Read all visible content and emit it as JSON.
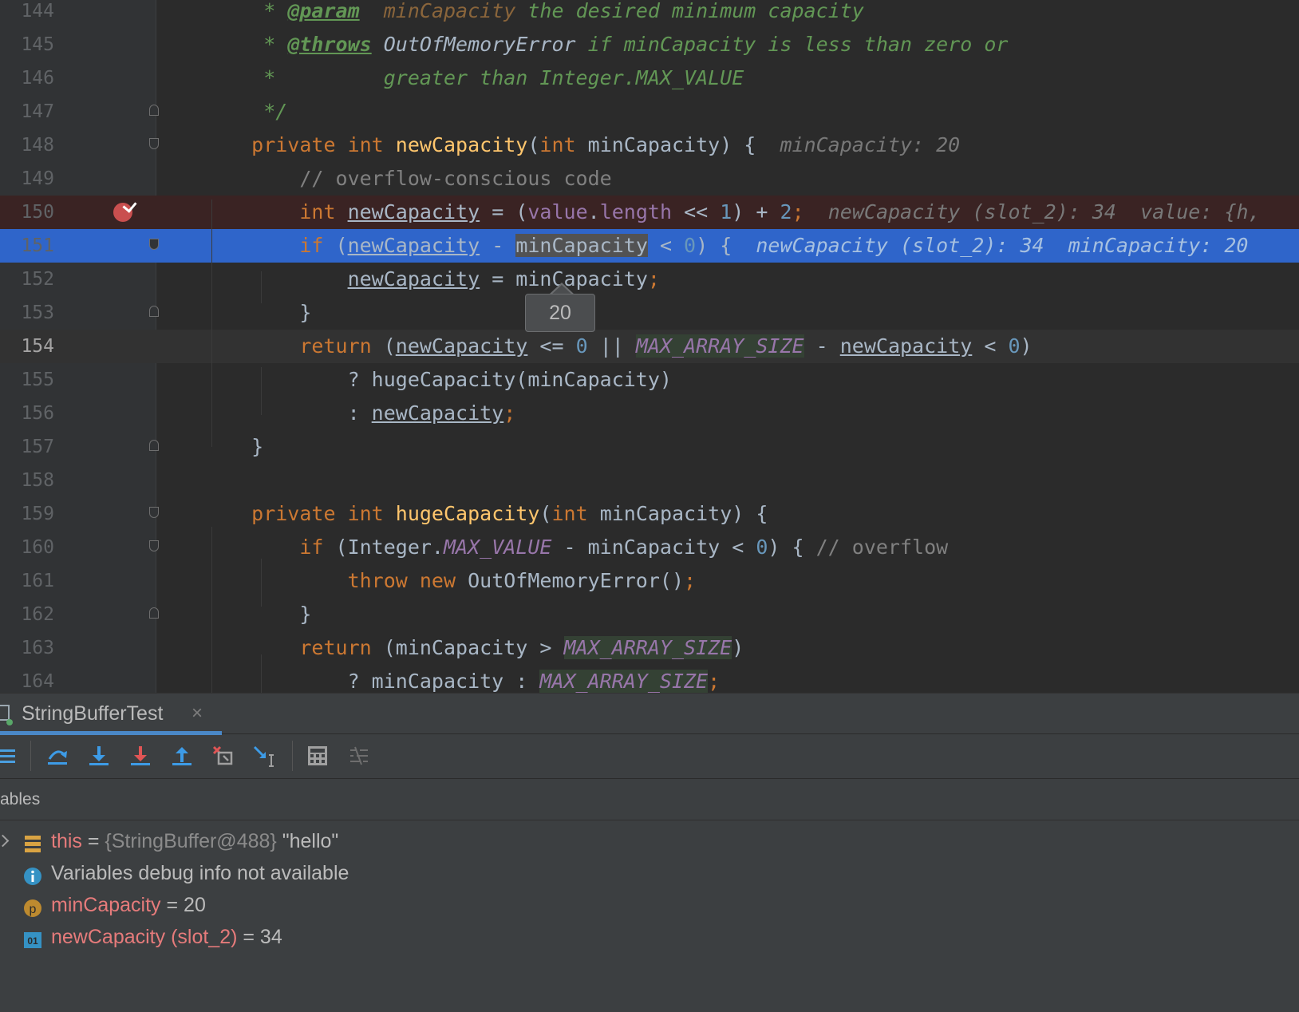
{
  "editor": {
    "lines": [
      {
        "n": "144",
        "html": "    <span class=\"doc\">* </span><span class=\"doctag\">@param</span><span class=\"doc\">  </span><span class=\"docparam\">minCapacity</span><span class=\"doc\"> the desired minimum capacity</span>"
      },
      {
        "n": "145",
        "html": "    <span class=\"doc\">* </span><span class=\"doctag\">@throws</span><span class=\"doc\"> </span><span class=\"doc\" style=\"color:#a9b7c6\">OutOfMemoryError</span><span class=\"doc\"> if minCapacity is less than zero or</span>"
      },
      {
        "n": "146",
        "html": "    <span class=\"doc\">*         greater than Integer.MAX_VALUE</span>"
      },
      {
        "n": "147",
        "html": "    <span class=\"doc\">*/</span>"
      },
      {
        "n": "148",
        "html": "   <span class=\"kw\">private int </span><span class=\"fn\">newCapacity</span>(<span class=\"kw\">int </span>minCapacity) {  <span class=\"hint\">minCapacity: 20</span>"
      },
      {
        "n": "149",
        "html": "       <span class=\"cmt\">// overflow-conscious code</span>"
      },
      {
        "n": "150",
        "html": "       <span class=\"kw\">int </span><span class=\"ul\">newCapacity</span> = (<span class=\"field\">value</span>.<span class=\"field\">length</span> &lt;&lt; <span class=\"num\">1</span>) + <span class=\"num\">2</span><span class=\"kw\">;</span>  <span class=\"hint\">newCapacity (slot_2): 34  value: {h,</span>"
      },
      {
        "n": "151",
        "html": "       <span class=\"kw\">if </span>(<span class=\"ul\">newCapacity</span> - <span class=\"hl-word\">minCapacity</span> &lt; <span class=\"num\">0</span>) {  <span class=\"hint\">newCapacity (slot_2): 34  minCapacity: 20</span>"
      },
      {
        "n": "152",
        "html": "           <span class=\"ul\">newCapacity</span> = minCapacity<span class=\"kw\">;</span>"
      },
      {
        "n": "153",
        "html": "       }"
      },
      {
        "n": "154",
        "html": "       <span class=\"kw\">return </span>(<span class=\"ul\">newCapacity</span> &lt;= <span class=\"num\">0</span> || <span class=\"static hl-green\">MAX_ARRAY_SIZE</span> - <span class=\"ul\">newCapacity</span> &lt; <span class=\"num\">0</span>)"
      },
      {
        "n": "155",
        "html": "           ? hugeCapacity(minCapacity)"
      },
      {
        "n": "156",
        "html": "           : <span class=\"ul\">newCapacity</span><span class=\"kw\">;</span>"
      },
      {
        "n": "157",
        "html": "   }"
      },
      {
        "n": "158",
        "html": ""
      },
      {
        "n": "159",
        "html": "   <span class=\"kw\">private int </span><span class=\"fn\">hugeCapacity</span>(<span class=\"kw\">int </span>minCapacity) {"
      },
      {
        "n": "160",
        "html": "       <span class=\"kw\">if </span>(Integer.<span class=\"static\">MAX_VALUE</span> - minCapacity &lt; <span class=\"num\">0</span>) { <span class=\"cmt\">// overflow</span>"
      },
      {
        "n": "161",
        "html": "           <span class=\"kw\">throw new </span>OutOfMemoryError()<span class=\"kw\">;</span>"
      },
      {
        "n": "162",
        "html": "       }"
      },
      {
        "n": "163",
        "html": "       <span class=\"kw\">return </span>(minCapacity &gt; <span class=\"static hl-green\">MAX_ARRAY_SIZE</span>)"
      },
      {
        "n": "164",
        "html": "           ? minCapacity : <span class=\"static hl-green\">MAX_ARRAY_SIZE</span><span class=\"kw\">;</span>"
      }
    ],
    "tooltip_value": "20"
  },
  "debug": {
    "tab_title": "StringBufferTest",
    "tab_close": "×",
    "vars_label": "ables",
    "toolbar_icons": [
      "layout-icon",
      "step-over-icon",
      "step-into-icon",
      "force-step-into-icon",
      "step-out-icon",
      "drop-frame-icon",
      "run-to-cursor-icon",
      "evaluate-expression-icon",
      "trace-current-stream-icon"
    ],
    "variables": {
      "this_name": "this",
      "this_eq": " = ",
      "this_obj": "{StringBuffer@488}",
      "this_val": " \"hello\"",
      "info_text": "Variables debug info not available",
      "min_name": "minCapacity",
      "min_val": " = 20",
      "new_name": "newCapacity (slot_2)",
      "new_val": " = 34"
    },
    "colors": {
      "accent": "#4a88c7",
      "breakpoint": "#c94f4f",
      "selection": "#2f65ca",
      "breakpoint_line": "#3a2323"
    }
  }
}
